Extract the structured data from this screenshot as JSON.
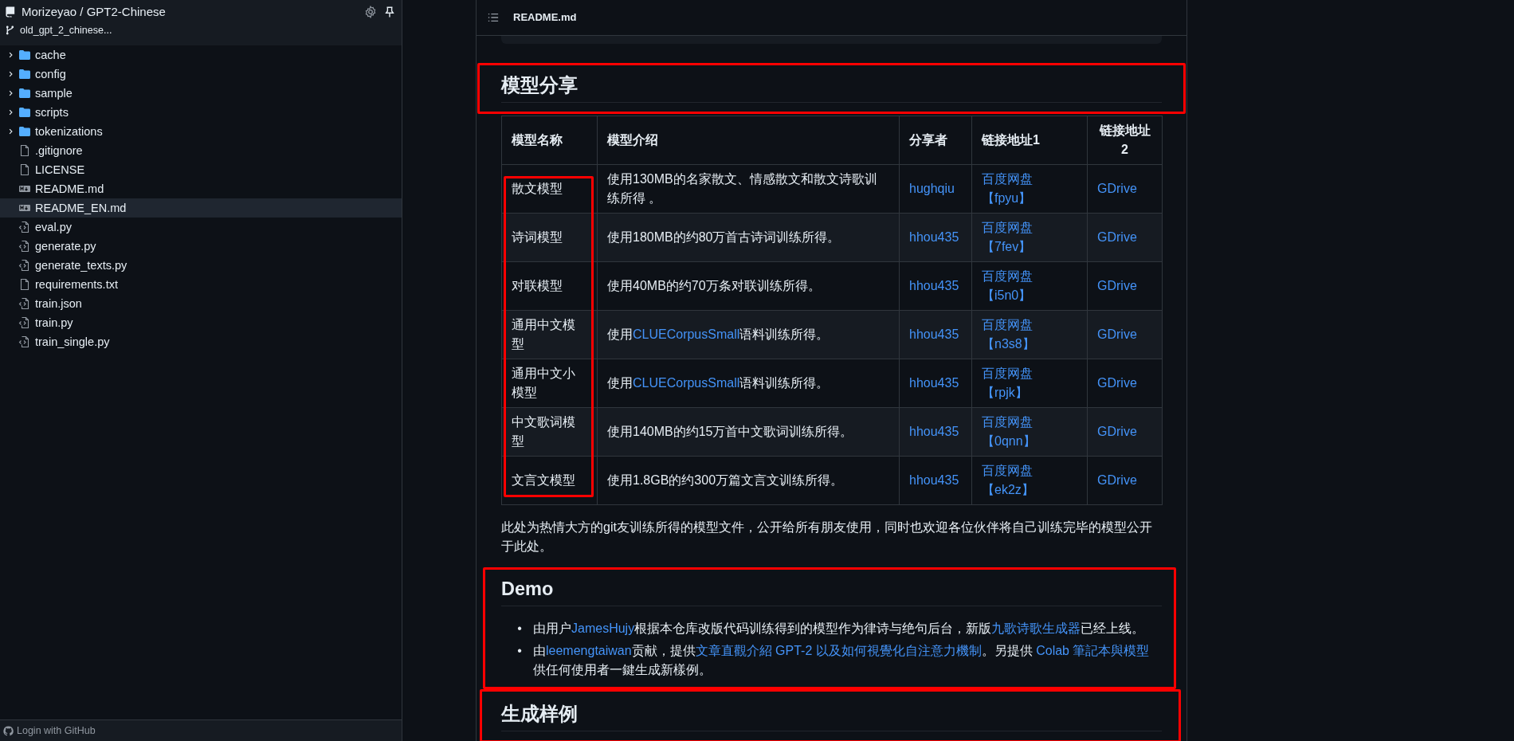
{
  "sidebar": {
    "repo": "Morizeyao / GPT2-Chinese",
    "branch": "old_gpt_2_chinese...",
    "items": [
      {
        "name": "cache",
        "kind": "folder",
        "expanded": false,
        "selected": false
      },
      {
        "name": "config",
        "kind": "folder",
        "expanded": false,
        "selected": false
      },
      {
        "name": "sample",
        "kind": "folder",
        "expanded": false,
        "selected": false
      },
      {
        "name": "scripts",
        "kind": "folder",
        "expanded": false,
        "selected": false
      },
      {
        "name": "tokenizations",
        "kind": "folder",
        "expanded": false,
        "selected": false
      },
      {
        "name": ".gitignore",
        "kind": "file",
        "selected": false
      },
      {
        "name": "LICENSE",
        "kind": "file",
        "selected": false
      },
      {
        "name": "README.md",
        "kind": "markdown",
        "selected": false
      },
      {
        "name": "README_EN.md",
        "kind": "markdown",
        "selected": true
      },
      {
        "name": "eval.py",
        "kind": "code",
        "selected": false
      },
      {
        "name": "generate.py",
        "kind": "code",
        "selected": false
      },
      {
        "name": "generate_texts.py",
        "kind": "code",
        "selected": false
      },
      {
        "name": "requirements.txt",
        "kind": "file",
        "selected": false
      },
      {
        "name": "train.json",
        "kind": "code",
        "selected": false
      },
      {
        "name": "train.py",
        "kind": "code",
        "selected": false
      },
      {
        "name": "train_single.py",
        "kind": "code",
        "selected": false
      }
    ],
    "login": "Login with GitHub"
  },
  "readme": {
    "title": "README.md",
    "sections": [
      {
        "kind": "table",
        "heading": "模型分享",
        "highlighted": true,
        "columns": [
          {
            "label": "模型名称",
            "highlighted": true
          },
          {
            "label": "模型介绍",
            "highlighted": false
          },
          {
            "label": "分享者",
            "highlighted": false
          },
          {
            "label": "链接地址1",
            "highlighted": false
          },
          {
            "label": "链接地址2",
            "highlighted": false
          }
        ],
        "rows": [
          {
            "name": "散文模型",
            "intro": [
              {
                "kind": "text",
                "text": "使用130MB的名家散文、情感散文和散文诗歌训练所得 。"
              }
            ],
            "sharer": "hughqiu",
            "link1": "百度网盘【fpyu】",
            "link2": "GDrive"
          },
          {
            "name": "诗词模型",
            "intro": [
              {
                "kind": "text",
                "text": "使用180MB的约80万首古诗词训练所得。"
              }
            ],
            "sharer": "hhou435",
            "link1": "百度网盘【7fev】",
            "link2": "GDrive"
          },
          {
            "name": "对联模型",
            "intro": [
              {
                "kind": "text",
                "text": "使用40MB的约70万条对联训练所得。"
              }
            ],
            "sharer": "hhou435",
            "link1": "百度网盘【i5n0】",
            "link2": "GDrive"
          },
          {
            "name": "通用中文模型",
            "intro": [
              {
                "kind": "text",
                "text": "使用"
              },
              {
                "kind": "link",
                "text": "CLUECorpusSmall"
              },
              {
                "kind": "text",
                "text": "语料训练所得。"
              }
            ],
            "sharer": "hhou435",
            "link1": "百度网盘【n3s8】",
            "link2": "GDrive"
          },
          {
            "name": "通用中文小模型",
            "intro": [
              {
                "kind": "text",
                "text": "使用"
              },
              {
                "kind": "link",
                "text": "CLUECorpusSmall"
              },
              {
                "kind": "text",
                "text": "语料训练所得。"
              }
            ],
            "sharer": "hhou435",
            "link1": "百度网盘【rpjk】",
            "link2": "GDrive"
          },
          {
            "name": "中文歌词模型",
            "intro": [
              {
                "kind": "text",
                "text": "使用140MB的约15万首中文歌词训练所得。"
              }
            ],
            "sharer": "hhou435",
            "link1": "百度网盘【0qnn】",
            "link2": "GDrive"
          },
          {
            "name": "文言文模型",
            "intro": [
              {
                "kind": "text",
                "text": "使用1.8GB的约300万篇文言文训练所得。"
              }
            ],
            "sharer": "hhou435",
            "link1": "百度网盘【ek2z】",
            "link2": "GDrive"
          }
        ],
        "note": "此处为热情大方的git友训练所得的模型文件，公开给所有朋友使用，同时也欢迎各位伙伴将自己训练完毕的模型公开于此处。"
      },
      {
        "kind": "list",
        "heading": "Demo",
        "highlighted": true,
        "bullet": "•",
        "items": [
          [
            {
              "kind": "text",
              "text": "由用户"
            },
            {
              "kind": "link",
              "text": "JamesHujy"
            },
            {
              "kind": "text",
              "text": "根据本仓库改版代码训练得到的模型作为律诗与绝句后台，新版"
            },
            {
              "kind": "link",
              "text": "九歌诗歌生成器"
            },
            {
              "kind": "text",
              "text": "已经上线。"
            }
          ],
          [
            {
              "kind": "text",
              "text": "由"
            },
            {
              "kind": "link",
              "text": "leemengtaiwan"
            },
            {
              "kind": "text",
              "text": "贡献，提供"
            },
            {
              "kind": "link",
              "text": "文章直觀介紹 GPT-2 以及如何視覺化自注意力機制"
            },
            {
              "kind": "text",
              "text": "。另提供 "
            },
            {
              "kind": "link",
              "text": "Colab 筆記本與模型"
            },
            {
              "kind": "text",
              "text": "供任何使用者一鍵生成新樣例。"
            }
          ]
        ]
      },
      {
        "kind": "heading",
        "heading": "生成样例",
        "highlighted": true
      }
    ]
  }
}
